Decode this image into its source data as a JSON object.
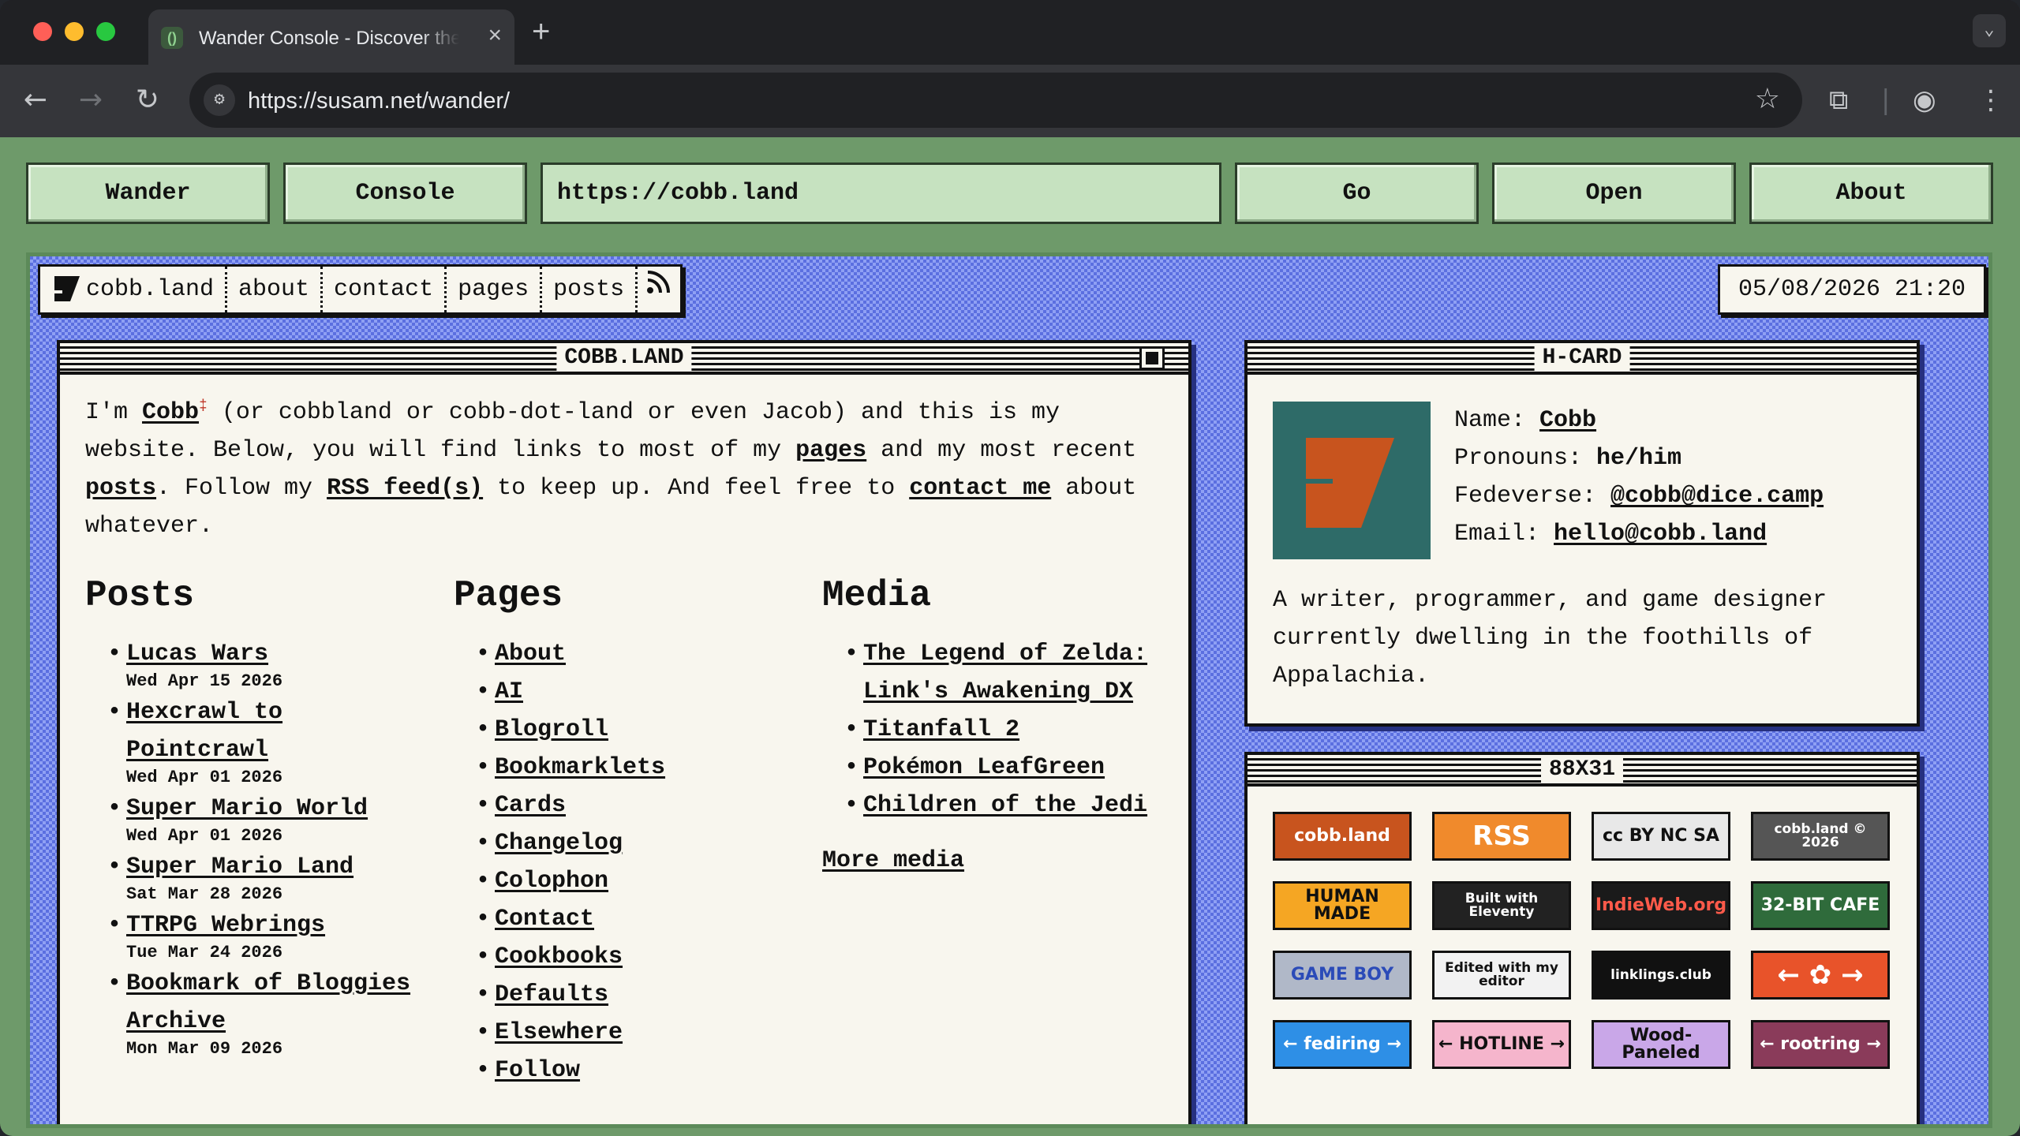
{
  "browser": {
    "tab_title": "Wander Console - Discover the",
    "url": "https://susam.net/wander/"
  },
  "console": {
    "wander_label": "Wander",
    "console_label": "Console",
    "url_value": "https://cobb.land",
    "go_label": "Go",
    "open_label": "Open",
    "about_label": "About"
  },
  "site": {
    "nav": [
      "cobb.land",
      "about",
      "contact",
      "pages",
      "posts"
    ],
    "datetime": "05/08/2026 21:20",
    "main_title": "COBB.LAND",
    "intro": {
      "t1": "I'm ",
      "cobb": "Cobb",
      "sup": "‡",
      "t2": " (or cobbland or cobb-dot-land or even Jacob) and this is my website. Below, you will find links to most of my ",
      "pages": "pages",
      "t3": " and my most recent ",
      "posts": "posts",
      "t4": ". Follow my ",
      "rss": "RSS feed(s)",
      "t5": " to keep up. And feel free to ",
      "contact": "contact me",
      "t6": " about whatever."
    },
    "posts_heading": "Posts",
    "posts": [
      {
        "title": "Lucas Wars",
        "date": "Wed Apr 15 2026"
      },
      {
        "title": "Hexcrawl to Pointcrawl",
        "date": "Wed Apr 01 2026"
      },
      {
        "title": "Super Mario World",
        "date": "Wed Apr 01 2026"
      },
      {
        "title": "Super Mario Land",
        "date": "Sat Mar 28 2026"
      },
      {
        "title": "TTRPG Webrings",
        "date": "Tue Mar 24 2026"
      },
      {
        "title": "Bookmark of Bloggies Archive",
        "date": "Mon Mar 09 2026"
      }
    ],
    "pages_heading": "Pages",
    "pages": [
      "About",
      "AI",
      "Blogroll",
      "Bookmarklets",
      "Cards",
      "Changelog",
      "Colophon",
      "Contact",
      "Cookbooks",
      "Defaults",
      "Elsewhere",
      "Follow"
    ],
    "media_heading": "Media",
    "media": [
      "The Legend of Zelda: Link's Awakening DX",
      "Titanfall 2",
      "Pokémon LeafGreen",
      "Children of the Jedi"
    ],
    "more_media": "More media",
    "hcard": {
      "title": "H-CARD",
      "name_label": "Name:",
      "name": "Cobb",
      "pronouns_label": "Pronouns:",
      "pronouns": "he/him",
      "fediverse_label": "Fedeverse:",
      "fediverse": "@cobb@dice.camp",
      "email_label": "Email:",
      "email": "hello@cobb.land",
      "bio": "A writer, programmer, and game designer currently dwelling in the foothills of Appalachia."
    },
    "badges_title": "88X31",
    "badges": [
      {
        "text": "cobb.land",
        "bg": "#c8541e",
        "fg": "#ffffff"
      },
      {
        "text": "RSS",
        "bg": "#f08a2c",
        "fg": "#ffffff"
      },
      {
        "text": "cc BY NC SA",
        "bg": "#e8e8e8",
        "fg": "#111111"
      },
      {
        "text": "cobb.land © 2026",
        "bg": "#555555",
        "fg": "#ffffff"
      },
      {
        "text": "HUMAN MADE",
        "bg": "#f5a623",
        "fg": "#111111"
      },
      {
        "text": "Built with Eleventy",
        "bg": "#222222",
        "fg": "#ffffff"
      },
      {
        "text": "IndieWeb.org",
        "bg": "#1a1a1a",
        "fg": "#ff5a4a"
      },
      {
        "text": "32-BIT CAFE",
        "bg": "#2f6b3b",
        "fg": "#ffffff"
      },
      {
        "text": "GAME BOY",
        "bg": "#b0b8c8",
        "fg": "#2b4bb8"
      },
      {
        "text": "Edited with my editor",
        "bg": "#f2f2f2",
        "fg": "#111111"
      },
      {
        "text": "linklings.club",
        "bg": "#111111",
        "fg": "#ffffff"
      },
      {
        "text": "← ✿ →",
        "bg": "#e8532a",
        "fg": "#ffffff"
      },
      {
        "text": "← fediring →",
        "bg": "#2e8fe6",
        "fg": "#ffffff"
      },
      {
        "text": "← HOTLINE →",
        "bg": "#f5b5cc",
        "fg": "#111111"
      },
      {
        "text": "Wood-Paneled",
        "bg": "#c9a7e8",
        "fg": "#111111"
      },
      {
        "text": "← rootring →",
        "bg": "#8a3b5a",
        "fg": "#ffffff"
      }
    ]
  }
}
